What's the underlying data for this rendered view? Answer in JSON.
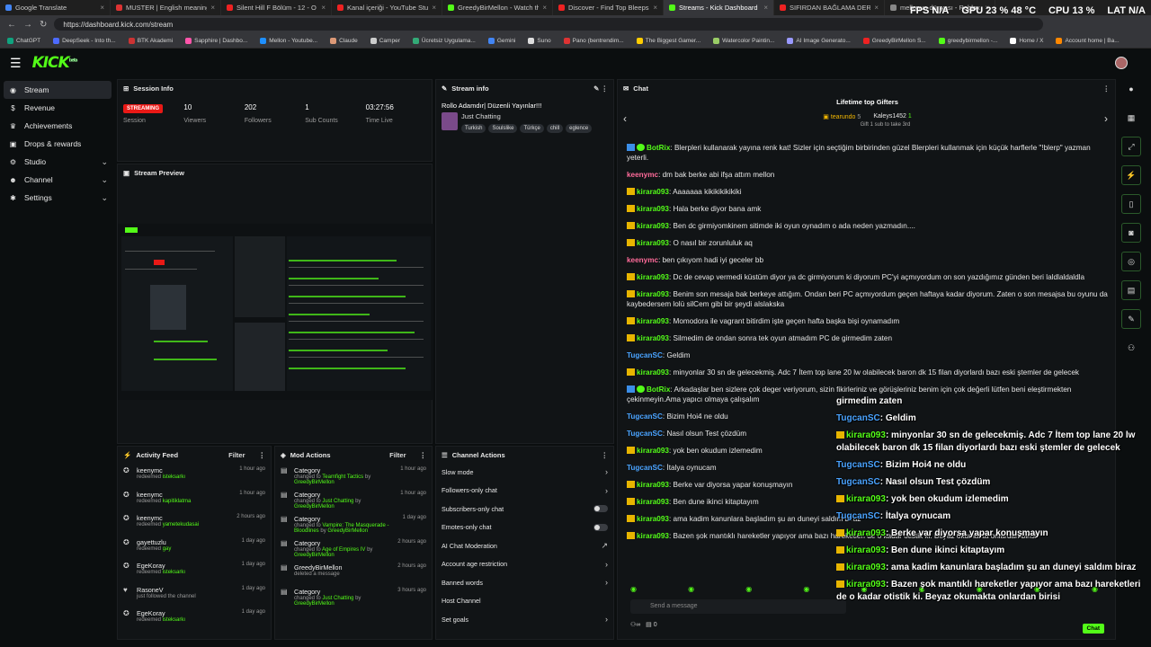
{
  "browser": {
    "tabs": [
      {
        "label": "Google Translate",
        "color": "#4285f4"
      },
      {
        "label": "MUSTER | English meaning - Camb",
        "color": "#d33"
      },
      {
        "label": "Silent Hill F Bölüm - 12 - O ikili ca",
        "color": "#e22"
      },
      {
        "label": "Kanal içeriği - YouTube Studio",
        "color": "#e22"
      },
      {
        "label": "GreedyBirMellon - Watch the VOD",
        "color": "#53fc18"
      },
      {
        "label": "Discover - Find Top Bleeps, Stream",
        "color": "#e22"
      },
      {
        "label": "Streams - Kick Dashboard",
        "color": "#53fc18",
        "active": true
      },
      {
        "label": "SIFIRDAN BAĞLAMA DERSİ 2 | Pe",
        "color": "#e22"
      },
      {
        "label": "mellonun dünyası - Roblox",
        "color": "#888"
      }
    ],
    "url": "https://dashboard.kick.com/stream",
    "stats": {
      "fps_label": "FPS",
      "fps": "N/A",
      "gpu_label": "GPU",
      "gpu": "23 % 48 °C",
      "cpu_label": "CPU",
      "cpu": "13 %",
      "lat_label": "LAT",
      "lat": "N/A"
    },
    "bookmarks": [
      "ChatGPT",
      "DeepSeek - Into th...",
      "BTK Akademi",
      "Sapphire | Dashbo...",
      "Mellon - Youtube...",
      "Claude",
      "Camper",
      "Ücretsiz Uygulama...",
      "Gemini",
      "Suno",
      "Pano (bentrendim...",
      "The Biggest Gamer...",
      "Watercolor Paintin...",
      "AI Image Generato...",
      "GreedyBirMellon S...",
      "greedybirmellon -...",
      "Home / X",
      "Account home | Ba..."
    ]
  },
  "header": {
    "logo": "KICK",
    "logo_sup": "beta"
  },
  "sidebar": {
    "items": [
      {
        "label": "Stream",
        "icon": "stream-icon",
        "active": true
      },
      {
        "label": "Revenue",
        "icon": "money-icon"
      },
      {
        "label": "Achievements",
        "icon": "trophy-icon"
      },
      {
        "label": "Drops & rewards",
        "icon": "gift-icon"
      },
      {
        "label": "Studio",
        "icon": "camera-icon",
        "chev": true
      },
      {
        "label": "Channel",
        "icon": "user-icon",
        "chev": true
      },
      {
        "label": "Settings",
        "icon": "gear-icon",
        "chev": true
      }
    ]
  },
  "session": {
    "title": "Session Info",
    "badge": "STREAMING",
    "badge_label": "Session",
    "stats": [
      {
        "value": "10",
        "label": "Viewers"
      },
      {
        "value": "202",
        "label": "Followers"
      },
      {
        "value": "1",
        "label": "Sub Counts"
      },
      {
        "value": "03:27:56",
        "label": "Time Live"
      }
    ]
  },
  "preview": {
    "title": "Stream Preview"
  },
  "stream_info": {
    "title": "Stream info",
    "stream_title": "Rollo Adamdır| Düzenli Yayınlar!!!",
    "category": "Just Chatting",
    "tags": [
      "Turkish",
      "Soulslike",
      "Türkçe",
      "chill",
      "eglence"
    ]
  },
  "chat": {
    "title": "Chat",
    "gifters_title": "Lifetime top Gifters",
    "gifter1": "tearundo",
    "gifter1_count": "5",
    "gifter2": "Kaleys1452",
    "gifter2_count": "1",
    "gift_hint": "Gift 1 sub to take 3rd",
    "messages": [
      {
        "user": "BotRix",
        "color": "#53fc18",
        "badge": "bot",
        "text": "Blerpleri kullanarak yayına renk kat! Sizler için seçtiğim birbirinden güzel Blerpleri kullanmak için küçük harflerle \"!blerp\" yazman yeterli."
      },
      {
        "user": "keenymc",
        "color": "#ff6b9a",
        "text": "dm bak berke abi ifşa attım mellon"
      },
      {
        "user": "kirara093",
        "color": "#53fc18",
        "badge": "crown",
        "text": "Aaaaaaa kikikikikikiki"
      },
      {
        "user": "kirara093",
        "color": "#53fc18",
        "badge": "crown",
        "text": "Hala berke diyor bana amk"
      },
      {
        "user": "kirara093",
        "color": "#53fc18",
        "badge": "crown",
        "text": "Ben dc girmiyomkinem sitimde iki oyun oynadım o ada neden yazmadın...."
      },
      {
        "user": "kirara093",
        "color": "#53fc18",
        "badge": "crown",
        "text": "O nasıl bir zorunluluk aq"
      },
      {
        "user": "keenymc",
        "color": "#ff6b9a",
        "text": "ben çıkıyom hadi iyi geceler bb"
      },
      {
        "user": "kirara093",
        "color": "#53fc18",
        "badge": "crown",
        "text": "Dc de cevap vermedi küstüm diyor ya dc girmiyorum ki diyorum PC'yi açmıyordum on son yazdığımız günden beri laldlaldaldla"
      },
      {
        "user": "kirara093",
        "color": "#53fc18",
        "badge": "crown",
        "text": "Benim son mesaja bak berkeye attığım. Ondan beri PC açmıyordum geçen haftaya kadar diyorum. Zaten o son mesajsa bu oyunu da kaybedersem lolü silCem gibi bir şeydi alslakska"
      },
      {
        "user": "kirara093",
        "color": "#53fc18",
        "badge": "crown",
        "text": "Momodora ile vagrant bitirdim işte geçen hafta başka bişi oynamadım"
      },
      {
        "user": "kirara093",
        "color": "#53fc18",
        "badge": "crown",
        "text": "Silmedim de ondan sonra tek oyun atmadım PC de girmedim zaten"
      },
      {
        "user": "TugcanSC",
        "color": "#4aa3ff",
        "text": "Geldim"
      },
      {
        "user": "kirara093",
        "color": "#53fc18",
        "badge": "crown",
        "text": "minyonlar 30 sn de gelecekmiş. Adc 7 İtem top lane 20 lw olabilecek baron dk 15 filan diyorlardı bazı eski ştemler de gelecek"
      },
      {
        "user": "BotRix",
        "color": "#53fc18",
        "badge": "bot",
        "text": "Arkadaşlar ben sizlere çok deger veriyorum, sizin fikirleriniz ve görüşleriniz benim için çok değerli lütfen beni eleştirmekten çekinmeyin.Ama yapıcı olmaya çalışalım"
      },
      {
        "user": "TugcanSC",
        "color": "#4aa3ff",
        "text": "Bizim Hoi4 ne oldu"
      },
      {
        "user": "TugcanSC",
        "color": "#4aa3ff",
        "text": "Nasıl olsun Test çözdüm"
      },
      {
        "user": "kirara093",
        "color": "#53fc18",
        "badge": "crown",
        "text": "yok ben okudum izlemedim"
      },
      {
        "user": "TugcanSC",
        "color": "#4aa3ff",
        "text": "İtalya oynucam"
      },
      {
        "user": "kirara093",
        "color": "#53fc18",
        "badge": "crown",
        "text": "Berke var diyorsa yapar konuşmayın"
      },
      {
        "user": "kirara093",
        "color": "#53fc18",
        "badge": "crown",
        "text": "Ben dune ikinci kitaptayım"
      },
      {
        "user": "kirara093",
        "color": "#53fc18",
        "badge": "crown",
        "text": "ama kadim kanunlara başladım şu an duneyi saldım biraz"
      },
      {
        "user": "kirara093",
        "color": "#53fc18",
        "badge": "crown",
        "text": "Bazen şok mantıklı hareketler yapıyor ama bazı hareketleri de o kadar otistik ki. Beyaz okumakta onlardan birisi"
      }
    ],
    "input_placeholder": "Send a message",
    "footer_count": "0",
    "chat_button": "Chat"
  },
  "overlay": {
    "messages": [
      {
        "user": "",
        "color": "#fff",
        "text": "girmedim zaten"
      },
      {
        "user": "TugcanSC",
        "color": "#4aa3ff",
        "text": "Geldim"
      },
      {
        "user": "kirara093",
        "color": "#53fc18",
        "badge": "crown",
        "text": "minyonlar 30 sn de gelecekmiş. Adc 7 İtem top lane 20 lw olabilecek baron dk 15 filan diyorlardı bazı eski ştemler de gelecek"
      },
      {
        "user": "TugcanSC",
        "color": "#4aa3ff",
        "text": "Bizim Hoi4 ne oldu"
      },
      {
        "user": "TugcanSC",
        "color": "#4aa3ff",
        "text": "Nasıl olsun Test çözdüm"
      },
      {
        "user": "kirara093",
        "color": "#53fc18",
        "badge": "crown",
        "text": "yok ben okudum izlemedim"
      },
      {
        "user": "TugcanSC",
        "color": "#4aa3ff",
        "text": "İtalya oynucam"
      },
      {
        "user": "kirara093",
        "color": "#53fc18",
        "badge": "crown",
        "text": "Berke var diyorsa yapar konuşmayın"
      },
      {
        "user": "kirara093",
        "color": "#53fc18",
        "badge": "crown",
        "text": "Ben dune ikinci kitaptayım"
      },
      {
        "user": "kirara093",
        "color": "#53fc18",
        "badge": "crown",
        "text": "ama kadim kanunlara başladım şu an duneyi saldım biraz"
      },
      {
        "user": "kirara093",
        "color": "#53fc18",
        "badge": "crown",
        "text": "Bazen şok mantıklı hareketler yapıyor ama bazı hareketleri de o kadar otistik ki. Beyaz okumakta onlardan birisi"
      }
    ]
  },
  "activity": {
    "title": "Activity Feed",
    "filter": "Filter",
    "items": [
      {
        "user": "keenymc",
        "desc": "redeemed",
        "item": "isteksarkı",
        "time": "1 hour ago",
        "icon": "reward-icon"
      },
      {
        "user": "keenymc",
        "desc": "redeemed",
        "item": "kapitiklatma",
        "time": "1 hour ago",
        "icon": "reward-icon"
      },
      {
        "user": "keenymc",
        "desc": "redeemed",
        "item": "yametekudasai",
        "time": "2 hours ago",
        "icon": "reward-icon"
      },
      {
        "user": "gayettuzlu",
        "desc": "redeemed",
        "item": "gay",
        "time": "1 day ago",
        "icon": "reward-icon"
      },
      {
        "user": "EgeKoray",
        "desc": "redeemed",
        "item": "isteksarkı",
        "time": "1 day ago",
        "icon": "reward-icon"
      },
      {
        "user": "RasoneV",
        "desc": "just followed the channel",
        "item": "",
        "time": "1 day ago",
        "icon": "heart-icon"
      },
      {
        "user": "EgeKoray",
        "desc": "redeemed",
        "item": "isteksarkı",
        "time": "1 day ago",
        "icon": "reward-icon"
      }
    ]
  },
  "mod_actions": {
    "title": "Mod Actions",
    "filter": "Filter",
    "items": [
      {
        "title": "Category",
        "line1": "changed to",
        "val": "Teamfight Tactics",
        "by": "by",
        "user": "GreedyBirMellon",
        "time": "1 hour ago"
      },
      {
        "title": "Category",
        "line1": "changed to",
        "val": "Just Chatting",
        "by": "by",
        "user": "GreedyBirMellon",
        "time": "1 hour ago"
      },
      {
        "title": "Category",
        "line1": "changed to",
        "val": "Vampire: The Masquerade - Bloodlines",
        "by": "by",
        "user": "GreedyBirMellon",
        "time": "1 day ago"
      },
      {
        "title": "Category",
        "line1": "changed to",
        "val": "Age of Empires IV",
        "by": "by",
        "user": "GreedyBirMellon",
        "time": "2 hours ago"
      },
      {
        "title": "GreedyBirMellon",
        "line1": "deleted a message",
        "val": "",
        "by": "",
        "user": "",
        "time": "2 hours ago"
      },
      {
        "title": "Category",
        "line1": "changed to",
        "val": "Just Chatting",
        "by": "by",
        "user": "GreedyBirMellon",
        "time": "3 hours ago"
      }
    ]
  },
  "channel_actions": {
    "title": "Channel Actions",
    "items": [
      {
        "label": "Slow mode",
        "ctrl": "chev"
      },
      {
        "label": "Followers-only chat",
        "ctrl": "chev"
      },
      {
        "label": "Subscribers-only chat",
        "ctrl": "toggle"
      },
      {
        "label": "Emotes-only chat",
        "ctrl": "toggle"
      },
      {
        "label": "AI Chat Moderation",
        "ctrl": "ext"
      },
      {
        "label": "Account age restriction",
        "ctrl": "chev"
      },
      {
        "label": "Banned words",
        "ctrl": "chev"
      },
      {
        "label": "Host Channel",
        "ctrl": ""
      },
      {
        "label": "Set goals",
        "ctrl": "chev"
      }
    ]
  }
}
